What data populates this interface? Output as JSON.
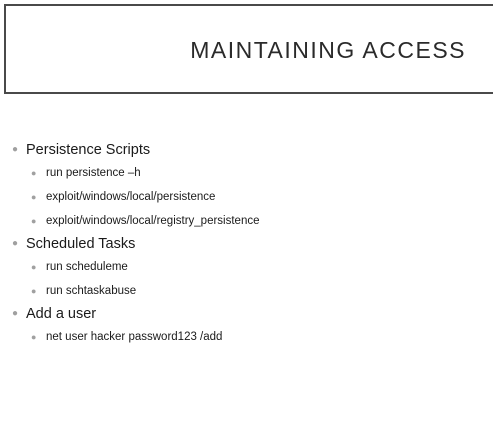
{
  "slide": {
    "title": "MAINTAINING ACCESS",
    "bullets": [
      {
        "label": "Persistence Scripts",
        "sub": [
          "run persistence –h",
          "exploit/windows/local/persistence",
          "exploit/windows/local/registry_persistence"
        ]
      },
      {
        "label": "Scheduled Tasks",
        "sub": [
          "run scheduleme",
          "run schtaskabuse"
        ]
      },
      {
        "label": "Add a user",
        "sub": [
          "net user hacker password123 /add"
        ]
      }
    ]
  },
  "colors": {
    "border": "#4a4a4a",
    "bullet": "#a0a0a0",
    "text": "#1a1a1a"
  }
}
